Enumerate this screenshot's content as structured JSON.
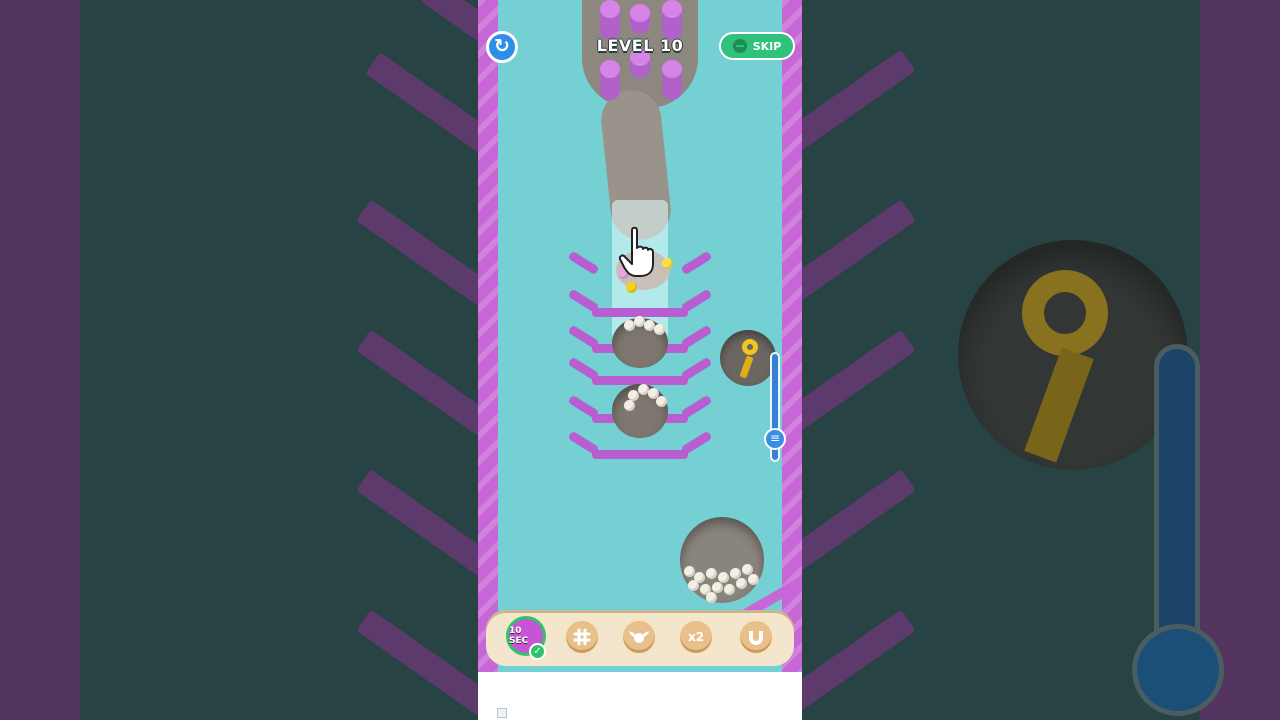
{
  "hud": {
    "level_label": "LEVEL 10",
    "skip_label": "SKIP",
    "restart_icon": "restart-icon"
  },
  "boosters": {
    "timer_label": "10 SEC",
    "items": [
      {
        "name": "grid-boost",
        "label": ""
      },
      {
        "name": "wings-boost",
        "label": ""
      },
      {
        "name": "double-boost",
        "label": "x2"
      },
      {
        "name": "magnet-boost",
        "label": ""
      }
    ]
  },
  "colors": {
    "track": "#74d0d2",
    "walls": "#c766d6",
    "skip": "#30c27a",
    "restart": "#2f8fe8",
    "key": "#f2c51f"
  },
  "slider": {
    "level_fraction": 0.75
  }
}
